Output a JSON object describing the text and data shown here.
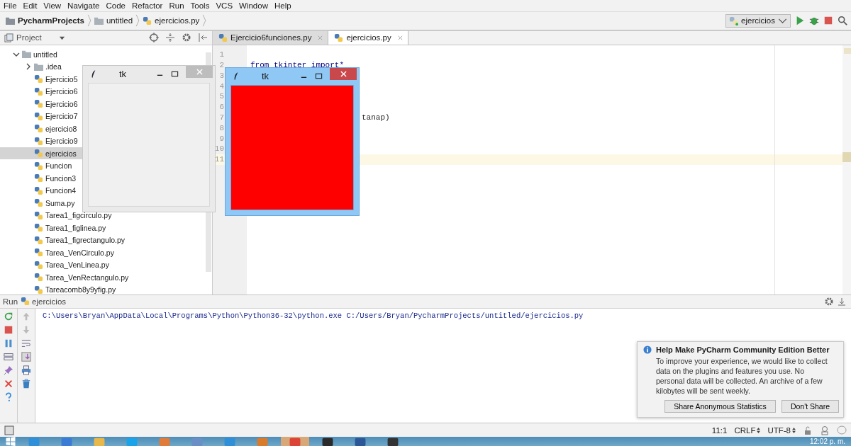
{
  "menu": [
    "File",
    "Edit",
    "View",
    "Navigate",
    "Code",
    "Refactor",
    "Run",
    "Tools",
    "VCS",
    "Window",
    "Help"
  ],
  "breadcrumbs": [
    {
      "label": "PycharmProjects",
      "kind": "root"
    },
    {
      "label": "untitled",
      "kind": "folder"
    },
    {
      "label": "ejercicios.py",
      "kind": "file"
    }
  ],
  "run_config": {
    "label": "ejercicios"
  },
  "project_panel": {
    "title": "Project",
    "tree": [
      {
        "label": "untitled",
        "kind": "folder",
        "expanded": true,
        "selected": false,
        "children": [
          {
            "label": ".idea",
            "kind": "folder",
            "expanded": false,
            "selected": false
          },
          {
            "label": "Ejercicio5",
            "kind": "file",
            "selected": false
          },
          {
            "label": "Ejercicio6",
            "kind": "file",
            "selected": false
          },
          {
            "label": "Ejercicio6",
            "kind": "file",
            "selected": false
          },
          {
            "label": "Ejercicio7",
            "kind": "file",
            "selected": false
          },
          {
            "label": "ejercicio8",
            "kind": "file",
            "selected": false
          },
          {
            "label": "Ejercicio9",
            "kind": "file",
            "selected": false
          },
          {
            "label": "ejercicios",
            "kind": "file",
            "selected": true
          },
          {
            "label": "Funcion",
            "kind": "file",
            "selected": false
          },
          {
            "label": "Funcion3",
            "kind": "file",
            "selected": false
          },
          {
            "label": "Funcion4",
            "kind": "file",
            "selected": false
          },
          {
            "label": "Suma.py",
            "kind": "file",
            "selected": false
          },
          {
            "label": "Tarea1_figcirculo.py",
            "kind": "file",
            "selected": false
          },
          {
            "label": "Tarea1_figlinea.py",
            "kind": "file",
            "selected": false
          },
          {
            "label": "Tarea1_figrectangulo.py",
            "kind": "file",
            "selected": false
          },
          {
            "label": "Tarea_VenCirculo.py",
            "kind": "file",
            "selected": false
          },
          {
            "label": "Tarea_VenLinea.py",
            "kind": "file",
            "selected": false
          },
          {
            "label": "Tarea_VenRectangulo.py",
            "kind": "file",
            "selected": false
          },
          {
            "label": "Tareacomb8y9yfig.py",
            "kind": "file",
            "selected": false
          }
        ]
      }
    ]
  },
  "editor_tabs": [
    {
      "label": "Ejercicio6funciones.py",
      "selected": false
    },
    {
      "label": "ejercicios.py",
      "selected": true
    }
  ],
  "code_lines": [
    {
      "number": "1",
      "kind": "plain",
      "current": false
    },
    {
      "number": "2",
      "text": "from tkinter import*",
      "kind": "plain",
      "current": false
    },
    {
      "number": "3",
      "kind": "plain",
      "current": false
    },
    {
      "number": "4",
      "kind": "plain",
      "current": false
    },
    {
      "number": "5",
      "kind": "plain",
      "current": false
    },
    {
      "number": "6",
      "kind": "plain",
      "current": false
    },
    {
      "number": "7",
      "text": "tanap)",
      "kind": "clipped",
      "current": false
    },
    {
      "number": "8",
      "kind": "plain",
      "current": false
    },
    {
      "number": "9",
      "kind": "plain",
      "current": false
    },
    {
      "number": "10",
      "kind": "plain",
      "current": false
    },
    {
      "number": "11",
      "kind": "plain",
      "current": true
    }
  ],
  "tk_windows": [
    {
      "title": "tk",
      "active": false,
      "color": "#f0f0f0"
    },
    {
      "title": "tk",
      "active": true,
      "color": "#ff0000"
    }
  ],
  "run_panel": {
    "title": "Run",
    "config": "ejercicios",
    "output": "C:\\Users\\Bryan\\AppData\\Local\\Programs\\Python\\Python36-32\\python.exe C:/Users/Bryan/PycharmProjects/untitled/ejercicios.py"
  },
  "notification": {
    "title": "Help Make PyCharm Community Edition Better",
    "body": "To improve your experience, we would like to collect data on the plugins and features you use. No personal data will be collected. An archive of a few kilobytes will be sent weekly.",
    "buttons": [
      "Share Anonymous Statistics",
      "Don't Share"
    ]
  },
  "status_bar": {
    "position": "11:1",
    "line_separator": "CRLF",
    "encoding": "UTF-8"
  },
  "taskbar": {
    "clock": "12:02 p. m."
  }
}
